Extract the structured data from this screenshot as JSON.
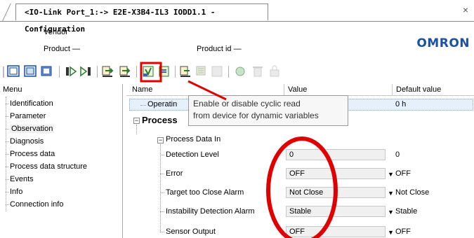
{
  "window": {
    "tab_title": "<IO-Link Port_1:-> E2E-X3B4-IL3 IODD1.1 - Configuration",
    "close_symbol": "×"
  },
  "header": {
    "vendor_label": "Vendor",
    "product_label": "Product —",
    "product_id_label": "Product id —",
    "logo_text": "OMRON"
  },
  "menu": {
    "title": "Menu",
    "items": [
      "Identification",
      "Parameter",
      "Observation",
      "Diagnosis",
      "Process data",
      "Process data structure",
      "Events",
      "Info",
      "Connection info"
    ]
  },
  "grid": {
    "columns": [
      "Name",
      "Value",
      "Default value"
    ],
    "rows": {
      "operating_name": "Operatin",
      "operating_default": "0 h",
      "process_group": "Process",
      "process_data_in": "Process Data In",
      "detection_level": {
        "name": "Detection Level",
        "value": "0",
        "default": "0"
      },
      "error": {
        "name": "Error",
        "value": "OFF",
        "default": "OFF"
      },
      "target_close": {
        "name": "Target too Close Alarm",
        "value": "Not Close",
        "default": "Not Close"
      },
      "instability": {
        "name": "Instability Detection Alarm",
        "value": "Stable",
        "default": "Stable"
      },
      "sensor_output": {
        "name": "Sensor Output",
        "value": "OFF",
        "default": "OFF"
      }
    }
  },
  "tooltip": {
    "line1": "Enable or disable cyclic read",
    "line2": "from device for dynamic variables"
  },
  "colors": {
    "highlight_red": "#e00000",
    "logo_blue": "#1d4fa3",
    "selected_row": "#e6f0fa"
  }
}
